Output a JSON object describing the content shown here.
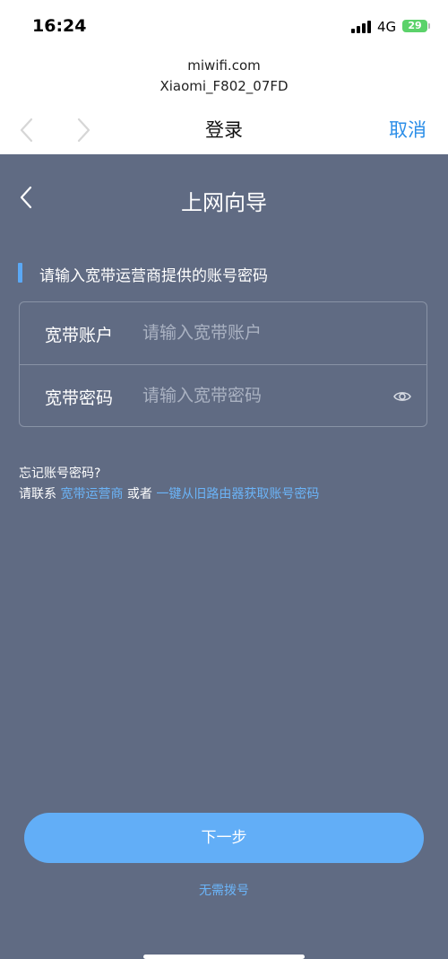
{
  "status_bar": {
    "time": "16:24",
    "network": "4G",
    "battery": "29"
  },
  "browser": {
    "domain": "miwifi.com",
    "ssid": "Xiaomi_F802_07FD"
  },
  "nav": {
    "title": "登录",
    "cancel_label": "取消",
    "back_icon": "chevron-left-icon",
    "forward_icon": "chevron-right-icon"
  },
  "page": {
    "title": "上网向导",
    "back_icon": "chevron-left-icon"
  },
  "form": {
    "section_title": "请输入宽带运营商提供的账号密码",
    "account": {
      "label": "宽带账户",
      "placeholder": "请输入宽带账户",
      "value": ""
    },
    "password": {
      "label": "宽带密码",
      "placeholder": "请输入宽带密码",
      "value": "",
      "toggle_icon": "eye-icon"
    }
  },
  "help": {
    "question": "忘记账号密码?",
    "prefix": "请联系",
    "link1": "宽带运营商",
    "middle": "或者",
    "link2": "一键从旧路由器获取账号密码"
  },
  "actions": {
    "next_label": "下一步",
    "skip_label": "无需拨号"
  },
  "colors": {
    "accent": "#62aef7",
    "link": "#6bb4f8",
    "panel_bg": "#606b83",
    "cancel": "#2b8ee8"
  }
}
